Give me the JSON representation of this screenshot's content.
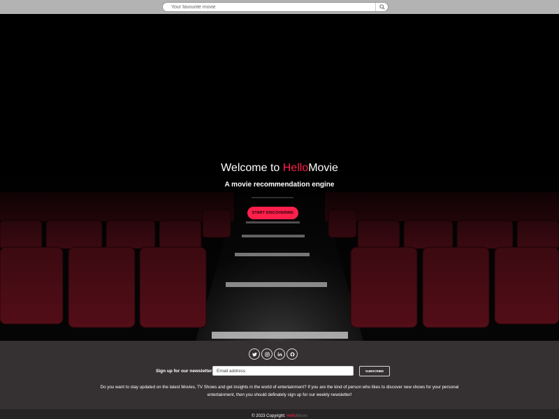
{
  "search": {
    "placeholder": "Your favourite movie",
    "icon": "search-icon"
  },
  "hero": {
    "title_prefix": "Welcome to ",
    "brand_hello": "Hello",
    "brand_movie": "Movie",
    "subtitle": "A movie recommendation engine",
    "cta_label": "START DISCOVERING"
  },
  "footer": {
    "socials": [
      {
        "name": "twitter",
        "icon": "twitter-icon"
      },
      {
        "name": "instagram",
        "icon": "instagram-icon"
      },
      {
        "name": "linkedin",
        "icon": "linkedin-icon"
      },
      {
        "name": "github",
        "icon": "github-icon"
      }
    ],
    "newsletter_label": "Sign up for our newsletter",
    "email_placeholder": "Email address",
    "subscribe_label": "SUBSCRIBE",
    "description": "Do you want to stay updated on the latest Movies, TV Shows and get insights in the world of entertainment? If you are the kind of person who likes to discover new shows for your personal entertainment, then you should definately sign up for our weekly newsletter!",
    "copyright_prefix": "© 2023 Copyright: ",
    "copyright_hello": "Hello",
    "copyright_movie": "Movie"
  },
  "colors": {
    "accent": "#ff1f4b",
    "footer_bg": "#353132",
    "seat": "#5a0f18"
  }
}
